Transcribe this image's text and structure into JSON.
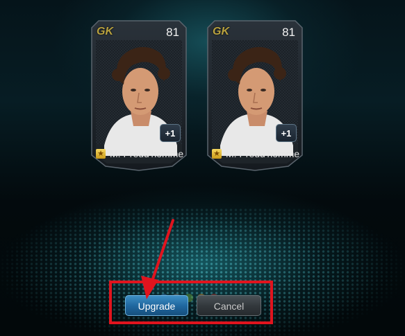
{
  "cards": [
    {
      "position": "GK",
      "rating": "81",
      "player_name": "M. Preud'homme",
      "upgrade_badge": "+1"
    },
    {
      "position": "GK",
      "rating": "81",
      "player_name": "M. Preud'homme",
      "upgrade_badge": "+1"
    }
  ],
  "actions": {
    "upgrade_label": "Upgrade",
    "cancel_label": "Cancel"
  },
  "icons": {
    "card_tier": "gold-star-icon",
    "upgrade": "plus-one-icon",
    "annotation": "red-arrow-icon"
  },
  "colors": {
    "position_text": "#b9a23f",
    "upgrade_button": "#2068a0",
    "cancel_button": "#33393d",
    "annotation_red": "#e0141e"
  }
}
